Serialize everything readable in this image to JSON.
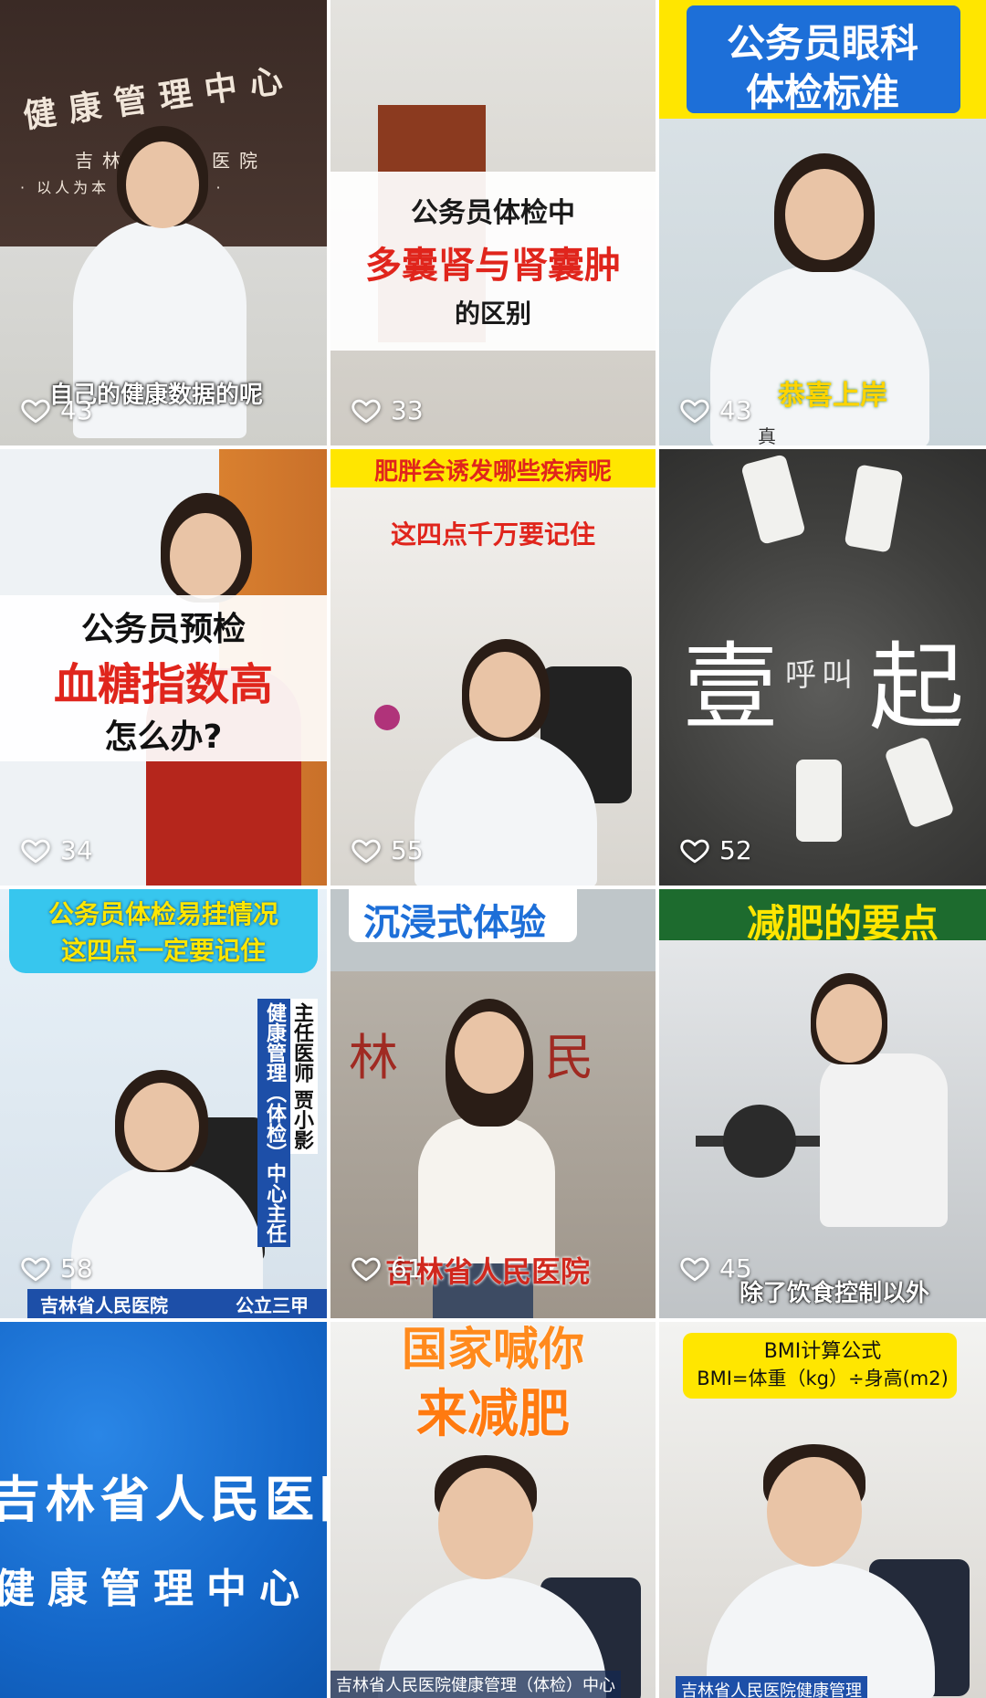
{
  "tiles": [
    {
      "likes": "43",
      "subtitle": "自己的健康数据的呢",
      "wall_title": "健康管理中心",
      "wall_sub": "吉林省人民医院",
      "wall_motto": "· 以人为本 · 精益求精 ·"
    },
    {
      "likes": "33",
      "line1": "公务员体检中",
      "line2": "多囊肾与肾囊肿",
      "line3": "的区别"
    },
    {
      "likes": "43",
      "line1": "公务员眼科",
      "line2": "体检标准",
      "sticker": "恭喜上岸",
      "char": "真"
    },
    {
      "likes": "34",
      "line1": "公务员预检",
      "line2": "血糖指数高",
      "line3": "怎么办?"
    },
    {
      "likes": "55",
      "line1": "肥胖会诱发哪些疾病呢",
      "line2": "这四点千万要记住"
    },
    {
      "likes": "52",
      "big_left": "壹",
      "big_mid": "呼叫",
      "big_right": "起"
    },
    {
      "likes": "58",
      "line1": "公务员体检易挂情况",
      "line2": "这四点一定要记住",
      "vert1": "主任医师 贾小影",
      "vert2": "健康管理（体检）中心主任",
      "footer_left": "吉林省人民医院",
      "footer_right": "公立三甲"
    },
    {
      "likes": "61",
      "line1": "沉浸式体验",
      "wall": "林 省 民",
      "footer": "吉林省人民医院"
    },
    {
      "likes": "45",
      "line1": "减肥的要点",
      "subtitle": "除了饮食控制以外"
    },
    {
      "line1": "吉林省人民医院",
      "line2": "健康管理中心"
    },
    {
      "line1": "国家喊你",
      "line2": "来减肥",
      "footer": "吉林省人民医院健康管理（体检）中心"
    },
    {
      "line1": "BMI计算公式",
      "line2": "BMI=体重（kg）÷身高(m2)",
      "footer": "吉林省人民医院健康管理"
    }
  ],
  "colors": {
    "red": "#e0251c",
    "yellow": "#ffe600",
    "blue": "#1d6fd8"
  },
  "icon": "heart-outline-icon"
}
